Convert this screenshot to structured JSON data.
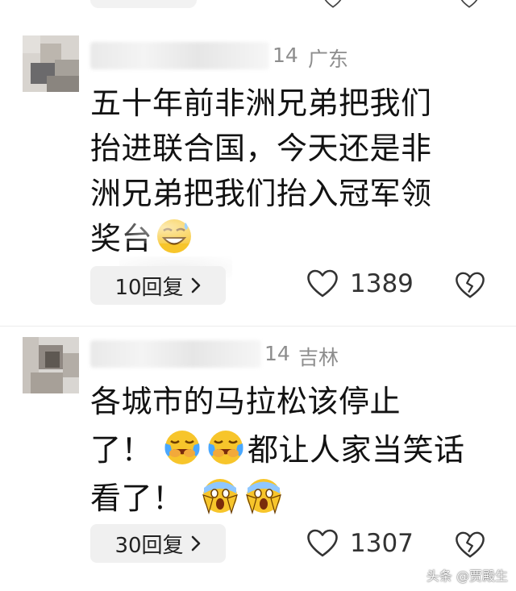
{
  "comments": [
    {
      "meta_suffix": "14",
      "location": "广东",
      "lines": [
        "五十年前非洲兄弟把我们",
        "抬进联合国，今天还是非",
        "洲兄弟把我们抬入冠军领",
        "奖台"
      ],
      "emojis": [
        "grin-sweat-emoji"
      ],
      "replies_label": "10回复",
      "likes": "1389"
    },
    {
      "meta_suffix": "14",
      "location": "吉林",
      "lines": [
        "各城市的马拉松该停止",
        "了！",
        "都让人家当笑话",
        "看了！"
      ],
      "emojis": [
        "laugh-cry-emoji",
        "laugh-cry-emoji",
        "scream-emoji",
        "scream-emoji"
      ],
      "replies_label": "30回复",
      "likes": "1307"
    }
  ],
  "watermark": "头条 @贾殿生",
  "icons": {
    "like": "heart-outline-icon",
    "dislike": "broken-heart-icon",
    "reply_chevron": "chevron-right-icon"
  },
  "colors": {
    "meta_gray": "#8d8d8d",
    "pill_bg": "#f0f0f0",
    "emoji_yellow": "#f7c52b"
  }
}
